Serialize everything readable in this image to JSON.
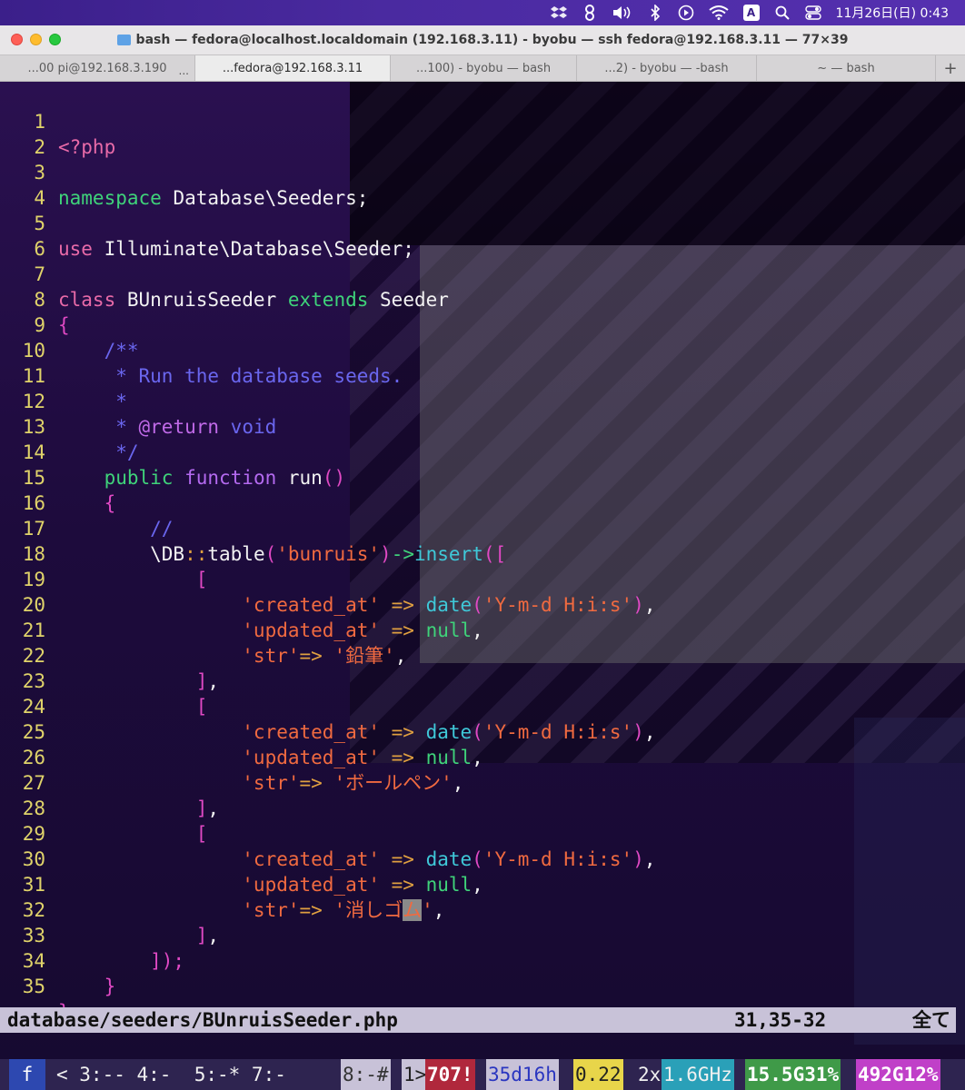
{
  "menubar": {
    "icons": [
      "dropbox-icon",
      "adobe-cc-icon",
      "volume-icon",
      "bluetooth-icon",
      "play-icon",
      "wifi-icon",
      "input-method-icon",
      "search-icon",
      "control-center-icon"
    ],
    "input_method": "A",
    "clock": "11月26日(日) 0:43"
  },
  "window": {
    "title": "bash — fedora@localhost.localdomain (192.168.3.11) - byobu — ssh fedora@192.168.3.11 — 77×39",
    "tabs": [
      {
        "label": "...00 pi@192.168.3.190",
        "more": "...",
        "active": false
      },
      {
        "label": "...fedora@192.168.3.11",
        "active": true
      },
      {
        "label": "...100) - byobu — bash",
        "active": false
      },
      {
        "label": "...2) - byobu — -bash",
        "active": false
      },
      {
        "label": "~ — bash",
        "active": false
      }
    ],
    "add_tab": "+"
  },
  "editor": {
    "lines": [
      {
        "n": "1"
      },
      {
        "n": "2"
      },
      {
        "n": "3"
      },
      {
        "n": "4"
      },
      {
        "n": "5"
      },
      {
        "n": "6"
      },
      {
        "n": "7"
      },
      {
        "n": "8"
      },
      {
        "n": "9"
      },
      {
        "n": "10"
      },
      {
        "n": "11"
      },
      {
        "n": "12"
      },
      {
        "n": "13"
      },
      {
        "n": "14"
      },
      {
        "n": "15"
      },
      {
        "n": "16"
      },
      {
        "n": "17"
      },
      {
        "n": "18"
      },
      {
        "n": "19"
      },
      {
        "n": "20"
      },
      {
        "n": "21"
      },
      {
        "n": "22"
      },
      {
        "n": "23"
      },
      {
        "n": "24"
      },
      {
        "n": "25"
      },
      {
        "n": "26"
      },
      {
        "n": "27"
      },
      {
        "n": "28"
      },
      {
        "n": "29"
      },
      {
        "n": "30"
      },
      {
        "n": "31"
      },
      {
        "n": "32"
      },
      {
        "n": "33"
      },
      {
        "n": "34"
      },
      {
        "n": "35"
      }
    ],
    "tokens": {
      "php_open": "<?php",
      "namespace_kw": "namespace",
      "namespace_val": " Database\\Seeders;",
      "use_kw": "use",
      "use_val": " Illuminate\\Database\\Seeder;",
      "class_kw": "class",
      "class_name": " BUnruisSeeder ",
      "extends_kw": "extends",
      "parent": " Seeder",
      "open_brace": "{",
      "doc_open": "    /**",
      "doc_run": "     * Run the database seeds.",
      "doc_star": "     *",
      "doc_return_pre": "     * ",
      "doc_return_tag": "@return",
      "doc_return_val": " void",
      "doc_close": "     */",
      "public_kw": "    public",
      "function_kw": " function",
      "run_name": " run",
      "run_parens": "()",
      "method_brace_open": "    {",
      "line_comment": "        //",
      "db_prefix": "        \\DB",
      "db_colons": "::",
      "db_table": "table",
      "paren_open": "(",
      "table_name": "'bunruis'",
      "paren_close": ")",
      "arrow_op": "->",
      "insert_fn": "insert",
      "insert_open": "([",
      "arr_open": "            [",
      "arr_close": "            ]",
      "comma": ",",
      "key_created": "                'created_at'",
      "key_updated": "                'updated_at'",
      "key_str": "                'str'",
      "fat_arrow": " => ",
      "fat_arrow_tight": "=> ",
      "date_fn": "date",
      "date_fmt": "'Y-m-d H:i:s'",
      "null_val": "null",
      "str1": "'鉛筆'",
      "str2": "'ボールペン'",
      "str3_pre": "'消しゴ",
      "str3_cursor": "ム",
      "str3_post": "'",
      "insert_close": "        ]);",
      "method_brace_close": "    }",
      "class_brace_close": "}",
      "tilde": "~"
    },
    "status": {
      "filename": "database/seeders/BUnruisSeeder.php",
      "position": "31,35-32",
      "scroll": "全て"
    }
  },
  "byobu": {
    "session": "f",
    "windows": "< 3:-- 4:-  5:-* 7:-",
    "win8": "8:-#",
    "win1": "1>",
    "updates": "707!",
    "uptime": "35d16h",
    "load": "0.22",
    "cpu_count": "2x",
    "cpu_freq": "1.6GHz",
    "mem": "15.5G31%",
    "disk": "492G12%"
  }
}
